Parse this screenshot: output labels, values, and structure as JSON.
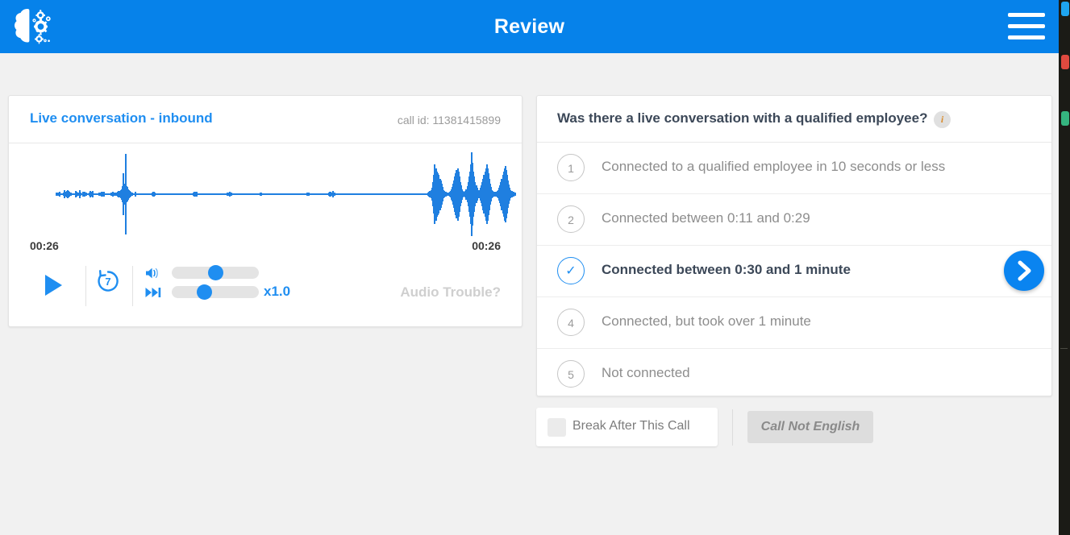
{
  "appbar": {
    "title": "Review",
    "logo_icon": "brain-gears-logo",
    "menu_icon": "hamburger-menu-icon",
    "background_color": "#0682ea"
  },
  "player": {
    "title": "Live conversation - inbound",
    "call_id": "call id: 11381415899",
    "time_current": "00:26",
    "time_total": "00:26",
    "play_icon": "play-icon",
    "rewind_seconds": "7",
    "rewind_icon": "replay-7-icon",
    "volume_icon": "speaker-icon",
    "speed_icon": "fast-forward-icon",
    "speed_value": "x1.0",
    "audio_trouble_label": "Audio Trouble?",
    "volume_percent": 50,
    "speed_percent": 35,
    "waveform_color": "#1f7fe0"
  },
  "question": {
    "text": "Was there a live conversation with a qualified employee?",
    "info_icon": "info-icon",
    "info_label": "i",
    "options": [
      {
        "number": "1",
        "label": "Connected to a qualified employee in 10 seconds or less",
        "selected": false
      },
      {
        "number": "2",
        "label": "Connected between 0:11 and 0:29",
        "selected": false
      },
      {
        "number": "✓",
        "label": "Connected between 0:30 and 1 minute",
        "selected": true
      },
      {
        "number": "4",
        "label": "Connected, but took over 1 minute",
        "selected": false
      },
      {
        "number": "5",
        "label": "Not connected",
        "selected": false
      }
    ],
    "next_icon": "chevron-right-icon",
    "accent_color": "#0a84f0"
  },
  "actions": {
    "break_label": "Break After This Call",
    "break_checked": false,
    "not_english_label": "Call Not English"
  },
  "right_strip": {
    "indicators": [
      "blue",
      "red",
      "green"
    ]
  },
  "waveform_bars": [
    2,
    2,
    1,
    2,
    3,
    1,
    1,
    1,
    2,
    5,
    3,
    2,
    4,
    5,
    4,
    3,
    2,
    1,
    1,
    1,
    1,
    1,
    4,
    3,
    1,
    2,
    5,
    2,
    1,
    1,
    3,
    3,
    3,
    2,
    2,
    1,
    1,
    2,
    4,
    3,
    3,
    4,
    1,
    1,
    1,
    1,
    1,
    1,
    2,
    2,
    2,
    3,
    2,
    3,
    3,
    1,
    1,
    1,
    1,
    1,
    1,
    1,
    2,
    2,
    3,
    2,
    2,
    2,
    2,
    3,
    4,
    3,
    4,
    5,
    6,
    9,
    24,
    12,
    46,
    9,
    8,
    6,
    5,
    4,
    3,
    2,
    2,
    1,
    1,
    3,
    1,
    1,
    1,
    1,
    1,
    1,
    1,
    1,
    1,
    1,
    1,
    1,
    1,
    1,
    1,
    1,
    1,
    1,
    2,
    3,
    3,
    2,
    1,
    1,
    1,
    1,
    1,
    1,
    1,
    1,
    1,
    1,
    1,
    1,
    1,
    1,
    1,
    1,
    1,
    1,
    1,
    1,
    1,
    1,
    1,
    1,
    1,
    1,
    1,
    1,
    1,
    1,
    1,
    1,
    1,
    1,
    1,
    1,
    1,
    1,
    1,
    1,
    1,
    1,
    1,
    2,
    3,
    3,
    3,
    1,
    1,
    1,
    1,
    1,
    1,
    1,
    1,
    1,
    1,
    1,
    1,
    1,
    1,
    1,
    1,
    1,
    1,
    1,
    1,
    1,
    1,
    1,
    1,
    1,
    1,
    1,
    1,
    1,
    1,
    1,
    1,
    1,
    1,
    2,
    2,
    2,
    3,
    2,
    2,
    1,
    1,
    1,
    1,
    1,
    1,
    1,
    1,
    1,
    1,
    1,
    1,
    1,
    1,
    1,
    1,
    1,
    1,
    1,
    1,
    1,
    1,
    1,
    1,
    1,
    1,
    1,
    1,
    1,
    1,
    1,
    2,
    2,
    1,
    1,
    1,
    1,
    1,
    1,
    1,
    1,
    1,
    1,
    1,
    1,
    1,
    1,
    1,
    1,
    1,
    1,
    1,
    1,
    1,
    1,
    1,
    1,
    1,
    1,
    1,
    1,
    1,
    1,
    1,
    1,
    1,
    1,
    1,
    1,
    1,
    1,
    1,
    1,
    1,
    1,
    1,
    1,
    1,
    1,
    1,
    1,
    1,
    1,
    1,
    2,
    2,
    2,
    1,
    1,
    1,
    1,
    1,
    1,
    1,
    1,
    1,
    1,
    1,
    1,
    1,
    1,
    1,
    1,
    1,
    1,
    1,
    1,
    1,
    1,
    2,
    3,
    3,
    2,
    4,
    2,
    2,
    1,
    1,
    1,
    1,
    1,
    1,
    1,
    1,
    1,
    1,
    1,
    1,
    1,
    1,
    1,
    1,
    1,
    1,
    1,
    1,
    1,
    1,
    1,
    1,
    1,
    1,
    1,
    1,
    1,
    1,
    1,
    1,
    1,
    1,
    1,
    1,
    1,
    1,
    1,
    1,
    1,
    1,
    1,
    1,
    1,
    1,
    1,
    1,
    1,
    1,
    1,
    1,
    1,
    1,
    1,
    1,
    1,
    1,
    1,
    1,
    1,
    1,
    1,
    1,
    1,
    1,
    1,
    1,
    1,
    1,
    1,
    1,
    1,
    1,
    1,
    1,
    1,
    1,
    1,
    1,
    1,
    1,
    1,
    1,
    1,
    1,
    1,
    1,
    1,
    1,
    1,
    1,
    1,
    1,
    1,
    1,
    1,
    1,
    1,
    1,
    1,
    1,
    1,
    1,
    1,
    2,
    3,
    4,
    5,
    7,
    14,
    22,
    34,
    28,
    30,
    26,
    24,
    22,
    18,
    16,
    12,
    8,
    5,
    4,
    3,
    3,
    2,
    2,
    2,
    3,
    4,
    6,
    8,
    12,
    16,
    20,
    24,
    28,
    30,
    26,
    20,
    14,
    10,
    6,
    4,
    3,
    3,
    4,
    6,
    9,
    14,
    20,
    26,
    34,
    48,
    36,
    26,
    20,
    14,
    10,
    7,
    5,
    4,
    5,
    7,
    10,
    14,
    18,
    22,
    26,
    30,
    34,
    30,
    24,
    18,
    12,
    8,
    5,
    4,
    3,
    3,
    3,
    3,
    4,
    5,
    7,
    10,
    14,
    18,
    22,
    26,
    30,
    32,
    28,
    22,
    16,
    11,
    7,
    5,
    4,
    3,
    3,
    2,
    2
  ]
}
